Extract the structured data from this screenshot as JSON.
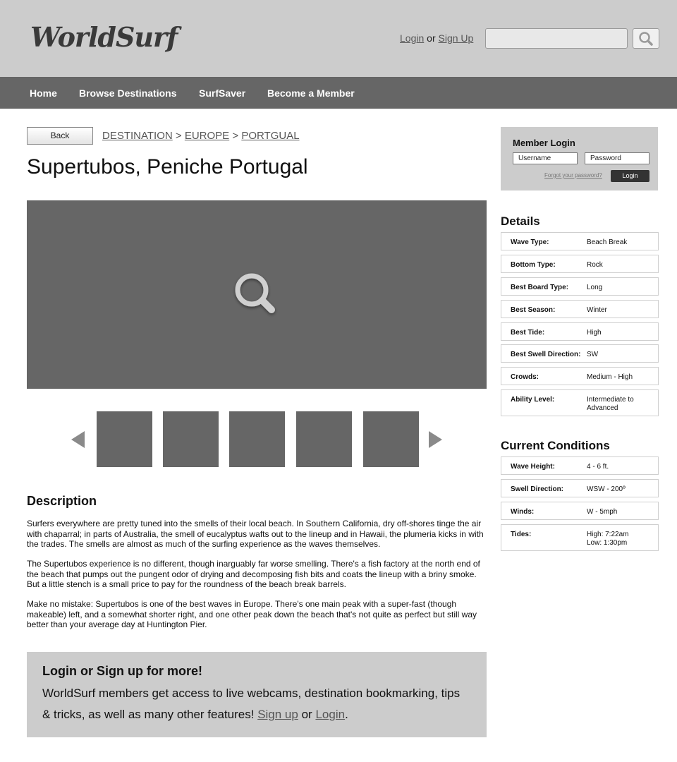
{
  "header": {
    "logo": "WorldSurf",
    "login_link": "Login",
    "or_text": "or",
    "signup_link": "Sign Up",
    "search_placeholder": ""
  },
  "nav": {
    "items": [
      "Home",
      "Browse Destinations",
      "SurfSaver",
      "Become a Member"
    ]
  },
  "breadcrumb": {
    "back_label": "Back",
    "items": [
      "DESTINATION",
      "EUROPE",
      "PORTGUAL"
    ],
    "separator": ">"
  },
  "page_title": "Supertubos, Peniche Portugal",
  "description": {
    "heading": "Description",
    "paragraphs": [
      "Surfers everywhere are pretty tuned into the smells of their local beach. In Southern California, dry off-shores tinge the air with chaparral; in parts of Australia, the smell of eucalyptus wafts out to the lineup and in Hawaii, the plumeria kicks in with the trades. The smells are almost as much of the surfing experience as the waves themselves.",
      "The Supertubos experience is no different, though inarguably far worse smelling. There's a fish factory at the north end of the beach that pumps out the pungent odor of drying and decomposing fish bits and coats the lineup with a briny smoke. But a little stench is a small price to pay for the roundness of the beach break barrels.",
      "Make no mistake: Supertubos is one of the best waves in Europe. There's one main peak with a super-fast (though makeable) left, and a somewhat shorter right, and one other peak down the beach that's not quite as perfect but still way better than your average day at Huntington Pier."
    ]
  },
  "cta": {
    "title": "Login or Sign up for more!",
    "text": "WorldSurf members get access to live webcams, destination bookmarking, tips & tricks, as well as many other features!",
    "signup_link": "Sign up",
    "or_text": "or",
    "login_link": "Login",
    "end_punct": "."
  },
  "member_login": {
    "title": "Member Login",
    "username_placeholder": "Username",
    "password_placeholder": "Password",
    "forgot_link": "Forgot your password?",
    "login_button": "Login"
  },
  "details": {
    "heading": "Details",
    "rows": [
      {
        "label": "Wave Type:",
        "value": "Beach Break"
      },
      {
        "label": "Bottom Type:",
        "value": "Rock"
      },
      {
        "label": "Best Board Type:",
        "value": "Long"
      },
      {
        "label": "Best Season:",
        "value": "Winter"
      },
      {
        "label": "Best Tide:",
        "value": "High"
      },
      {
        "label": "Best Swell Direction:",
        "value": "SW"
      },
      {
        "label": "Crowds:",
        "value": "Medium - High"
      },
      {
        "label": "Ability Level:",
        "value": "Intermediate to Advanced"
      }
    ]
  },
  "conditions": {
    "heading": "Current Conditions",
    "rows": [
      {
        "label": "Wave Height:",
        "value": "4 - 6 ft."
      },
      {
        "label": "Swell Direction:",
        "value": "WSW - 200º"
      },
      {
        "label": "Winds:",
        "value": "W - 5mph"
      },
      {
        "label": "Tides:",
        "value": "High: 7:22am",
        "value2": "Low: 1:30pm"
      }
    ]
  },
  "colors": {
    "header_bg": "#cccccc",
    "nav_bg": "#666666",
    "placeholder_gray": "#666666",
    "panel_bg": "#cccccc"
  },
  "icons": {
    "search": "search-icon",
    "hero_magnifier": "search-icon",
    "carousel_prev": "arrow-left-icon",
    "carousel_next": "arrow-right-icon"
  }
}
